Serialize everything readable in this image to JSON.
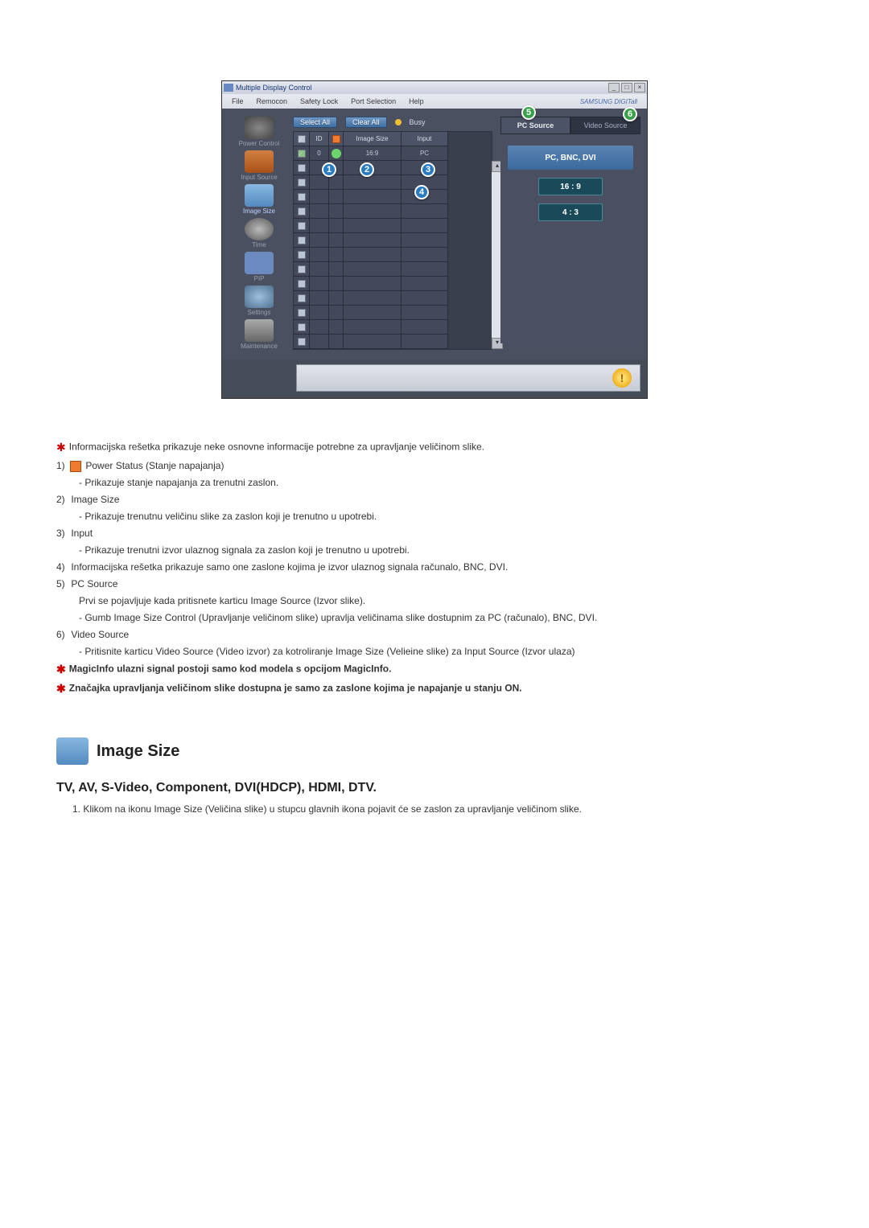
{
  "window": {
    "title": "Multiple Display Control",
    "brand": "SAMSUNG DIGITall"
  },
  "menu": {
    "file": "File",
    "remocon": "Remocon",
    "safety_lock": "Safety Lock",
    "port_selection": "Port Selection",
    "help": "Help"
  },
  "sidebar": {
    "items": [
      {
        "label": "Power Control"
      },
      {
        "label": "Input Source"
      },
      {
        "label": "Image Size"
      },
      {
        "label": "Time"
      },
      {
        "label": "PIP"
      },
      {
        "label": "Settings"
      },
      {
        "label": "Maintenance"
      }
    ]
  },
  "toolbar": {
    "select_all": "Select All",
    "clear_all": "Clear All",
    "busy": "Busy"
  },
  "grid": {
    "headers": {
      "check": "☑",
      "id": "ID",
      "power": " ",
      "image_size": "Image Size",
      "input": "Input"
    },
    "row1": {
      "id": "0",
      "image_size": "16:9",
      "input": "PC"
    }
  },
  "right": {
    "tabs": {
      "pc": "PC Source",
      "video": "Video Source"
    },
    "group": "PC, BNC, DVI",
    "ratio169": "16 : 9",
    "ratio43": "4 : 3"
  },
  "markers": {
    "m1": "1",
    "m2": "2",
    "m3": "3",
    "m4": "4",
    "m5": "5",
    "m6": "6"
  },
  "explain": {
    "intro": "Informacijska rešetka prikazuje neke osnovne informacije potrebne za upravljanje veličinom slike.",
    "i1_label": "Power Status (Stanje napajanja)",
    "i1_sub": "- Prikazuje stanje napajanja za trenutni zaslon.",
    "i2_label": "Image Size",
    "i2_sub": "- Prikazuje trenutnu veličinu slike za zaslon koji je trenutno u upotrebi.",
    "i3_label": "Input",
    "i3_sub": "- Prikazuje trenutni izvor ulaznog signala za zaslon koji je trenutno u upotrebi.",
    "i4_label": "Informacijska rešetka prikazuje samo one zaslone kojima je izvor ulaznog signala računalo, BNC, DVI.",
    "i5_label": "PC Source",
    "i5_sub1": "Prvi se pojavljuje kada pritisnete karticu Image Source (Izvor slike).",
    "i5_sub2": "- Gumb Image Size Control (Upravljanje veličinom slike) upravlja veličinama slike dostupnim za PC (računalo), BNC, DVI.",
    "i6_label": "Video Source",
    "i6_sub": "- Pritisnite karticu Video Source (Video izvor) za kotroliranje Image Size (Velieine slike) za Input Source (Izvor ulaza)",
    "note1": "MagicInfo ulazni signal postoji samo kod modela s opcijom MagicInfo.",
    "note2": "Značajka upravljanja veličinom slike dostupna je samo za zaslone kojima je napajanje u stanju ON."
  },
  "section": {
    "title": "Image Size",
    "subtitle": "TV, AV, S-Video, Component, DVI(HDCP), HDMI, DTV.",
    "item1": "1. Klikom na ikonu Image Size (Veličina slike) u stupcu glavnih ikona pojavit će se zaslon za upravljanje veličinom slike."
  }
}
